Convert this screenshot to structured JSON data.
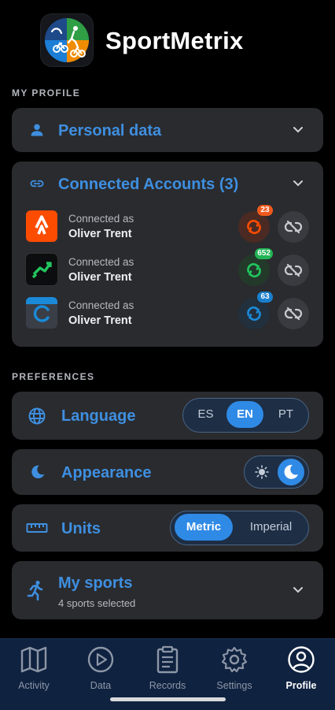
{
  "app": {
    "name": "SportMetrix"
  },
  "sections": {
    "profile": "MY PROFILE",
    "preferences": "PREFERENCES"
  },
  "personal": {
    "title": "Personal data"
  },
  "connected": {
    "title": "Connected Accounts (3)",
    "accounts": [
      {
        "service": "strava",
        "caption": "Connected as",
        "name": "Oliver Trent",
        "badge": "23",
        "color": "#fc4c02"
      },
      {
        "service": "wahoo",
        "caption": "Connected as",
        "name": "Oliver Trent",
        "badge": "652",
        "color": "#22c55e"
      },
      {
        "service": "garmin",
        "caption": "Connected as",
        "name": "Oliver Trent",
        "badge": "63",
        "color": "#1a8ad8"
      }
    ]
  },
  "language": {
    "title": "Language",
    "options": [
      "ES",
      "EN",
      "PT"
    ],
    "selected": "EN"
  },
  "appearance": {
    "title": "Appearance",
    "options": [
      "light",
      "dark"
    ],
    "selected": "dark"
  },
  "units": {
    "title": "Units",
    "options": [
      "Metric",
      "Imperial"
    ],
    "selected": "Metric"
  },
  "sports": {
    "title": "My sports",
    "subtitle": "4 sports selected"
  },
  "nav": {
    "items": [
      {
        "label": "Activity",
        "icon": "map-icon"
      },
      {
        "label": "Data",
        "icon": "play-circle-icon"
      },
      {
        "label": "Records",
        "icon": "clipboard-icon"
      },
      {
        "label": "Settings",
        "icon": "gear-icon"
      },
      {
        "label": "Profile",
        "icon": "user-circle-icon"
      }
    ],
    "active": "Profile"
  },
  "colors": {
    "accent": "#3e8fe0",
    "card": "#2a2b2f",
    "background": "#000000",
    "nav": "#0f2240"
  }
}
